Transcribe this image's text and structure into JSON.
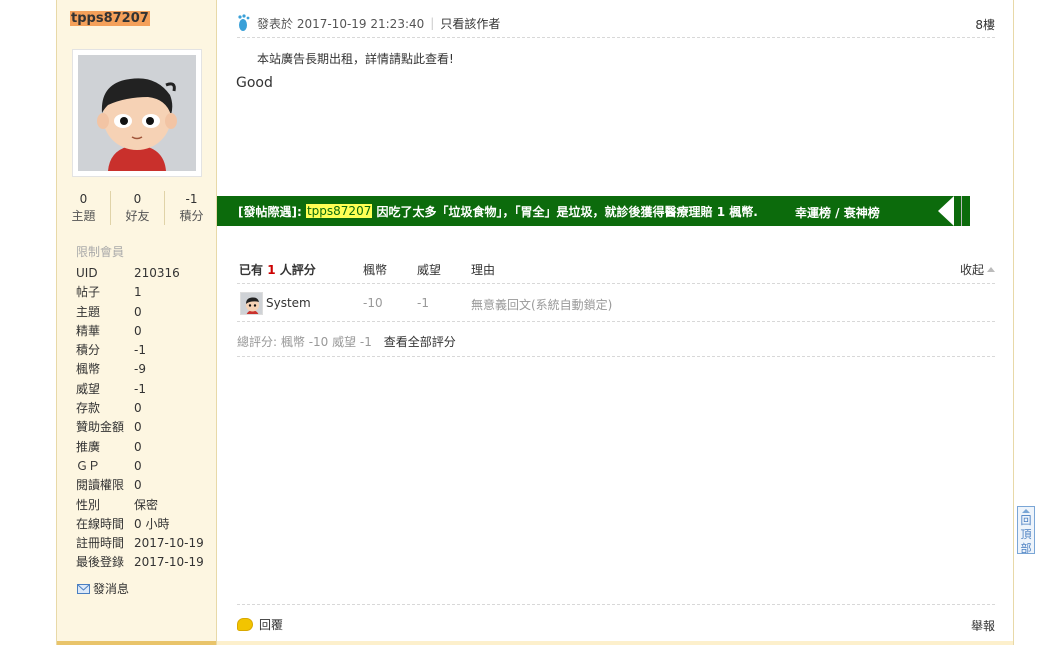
{
  "user": {
    "name": "tpps87207",
    "stats": [
      {
        "value": "0",
        "label": "主題"
      },
      {
        "value": "0",
        "label": "好友"
      },
      {
        "value": "-1",
        "label": "積分"
      }
    ],
    "group": "限制會員",
    "info": [
      {
        "key": "UID",
        "value": "210316"
      },
      {
        "key": "帖子",
        "value": "1"
      },
      {
        "key": "主題",
        "value": "0"
      },
      {
        "key": "精華",
        "value": "0"
      },
      {
        "key": "積分",
        "value": "-1"
      },
      {
        "key": "楓幣",
        "value": "-9"
      },
      {
        "key": "威望",
        "value": "-1"
      },
      {
        "key": "存款",
        "value": "0"
      },
      {
        "key": "贊助金額",
        "value": "0"
      },
      {
        "key": "推廣",
        "value": "0"
      },
      {
        "key": "ＧＰ",
        "value": "0"
      },
      {
        "key": "閱讀權限",
        "value": "0"
      },
      {
        "key": "性別",
        "value": "保密"
      },
      {
        "key": "在線時間",
        "value": "0 小時"
      },
      {
        "key": "註冊時間",
        "value": "2017-10-19"
      },
      {
        "key": "最後登錄",
        "value": "2017-10-19"
      }
    ],
    "send_message": "發消息"
  },
  "post": {
    "posted_at": "發表於 2017-10-19 21:23:40",
    "separator": "|",
    "author_only": "只看該作者",
    "floor": "8樓",
    "ad_text": "本站廣告長期出租，詳情請點此查看!",
    "content": "Good"
  },
  "banner": {
    "prefix": "[發帖際遇]:",
    "user": "tpps87207",
    "message": "因吃了太多「垃圾食物」，「胃全」是垃圾，就診後獲得醫療理賠 1 楓幣.",
    "fortune_link": "幸運榜 / 衰神榜"
  },
  "rating": {
    "count_prefix": "已有",
    "count": "1",
    "count_suffix": "人評分",
    "col_maple": "楓幣",
    "col_prestige": "威望",
    "col_reason": "理由",
    "collapse": "收起",
    "rows": [
      {
        "user": "System",
        "maple": "-10",
        "prestige": "-1",
        "reason": "無意義回文(系統自動鎖定)"
      }
    ],
    "total_label": "總評分:",
    "total_values": "楓幣 -10  威望 -1",
    "view_all": "查看全部評分"
  },
  "footer": {
    "reply": "回覆",
    "report": "舉報"
  },
  "back_to_top": "回頂部",
  "colors": {
    "sidebar_bg": "#fdf6e1",
    "banner_green": "#0c6b0c",
    "username_highlight": "#f4a05a",
    "banner_highlight": "#ffff55"
  }
}
